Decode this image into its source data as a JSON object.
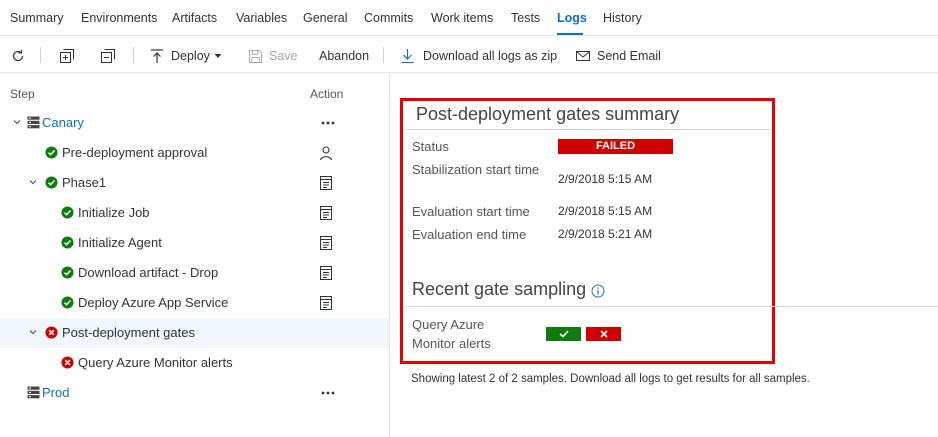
{
  "tabs": [
    {
      "label": "Summary"
    },
    {
      "label": "Environments"
    },
    {
      "label": "Artifacts"
    },
    {
      "label": "Variables"
    },
    {
      "label": "General"
    },
    {
      "label": "Commits"
    },
    {
      "label": "Work items"
    },
    {
      "label": "Tests"
    },
    {
      "label": "Logs",
      "active": true
    },
    {
      "label": "History"
    }
  ],
  "toolbar": {
    "refresh_icon": "refresh-icon",
    "expand_icon": "expand-all-icon",
    "collapse_icon": "collapse-all-icon",
    "deploy_label": "Deploy",
    "save_label": "Save",
    "abandon_label": "Abandon",
    "download_label": "Download all logs as zip",
    "email_label": "Send Email"
  },
  "steps_panel": {
    "step_header": "Step",
    "action_header": "Action",
    "rows": [
      {
        "label": "Canary",
        "type": "environment",
        "status": "none",
        "action": "more"
      },
      {
        "label": "Pre-deployment approval",
        "type": "step",
        "status": "success",
        "action": "person"
      },
      {
        "label": "Phase1",
        "type": "phase",
        "status": "success",
        "action": "log"
      },
      {
        "label": "Initialize Job",
        "type": "task",
        "status": "success",
        "action": "log"
      },
      {
        "label": "Initialize Agent",
        "type": "task",
        "status": "success",
        "action": "log"
      },
      {
        "label": "Download artifact - Drop",
        "type": "task",
        "status": "success",
        "action": "log"
      },
      {
        "label": "Deploy Azure App Service",
        "type": "task",
        "status": "success",
        "action": "log"
      },
      {
        "label": "Post-deployment gates",
        "type": "phase",
        "status": "failed",
        "action": "none",
        "selected": true
      },
      {
        "label": "Query Azure Monitor alerts",
        "type": "task",
        "status": "failed",
        "action": "none"
      },
      {
        "label": "Prod",
        "type": "environment",
        "status": "none",
        "action": "more"
      }
    ]
  },
  "gates_summary": {
    "title": "Post-deployment gates summary",
    "status_label": "Status",
    "status_value": "FAILED",
    "stabilization_label": "Stabilization start time",
    "stabilization_value": "2/9/2018 5:15 AM",
    "eval_start_label": "Evaluation start time",
    "eval_start_value": "2/9/2018 5:15 AM",
    "eval_end_label": "Evaluation end time",
    "eval_end_value": "2/9/2018 5:21 AM"
  },
  "recent_sampling": {
    "title": "Recent gate sampling",
    "gate_name": "Query Azure Monitor alerts",
    "samples": [
      {
        "result": "pass",
        "color": "#107c10"
      },
      {
        "result": "fail",
        "color": "#d10000"
      }
    ],
    "footnote": "Showing latest 2 of 2 samples. Download all logs to get results for all samples."
  },
  "colors": {
    "accent": "#106ebe",
    "success": "#107c10",
    "failure": "#d10000",
    "highlight_box": "#e60000"
  }
}
